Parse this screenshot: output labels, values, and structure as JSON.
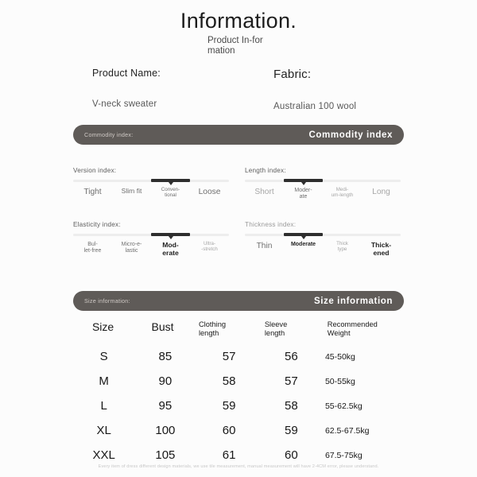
{
  "header": {
    "title": "Information.",
    "subtitle": "Product In-formation"
  },
  "product": {
    "name_label": "Product Name:",
    "name_value": "V-neck sweater",
    "fabric_label": "Fabric:",
    "fabric_value": "Australian 100 wool"
  },
  "commodity_banner": {
    "left": "Commodity index:",
    "right": "Commodity index"
  },
  "size_banner": {
    "left": "Size information:",
    "right": "Size information"
  },
  "indexes": [
    {
      "title": "Version index:",
      "selected": 3,
      "options": [
        "Tight",
        "Slim fit",
        "Conven-\ntional",
        "Loose"
      ]
    },
    {
      "title": "Length index:",
      "selected": 2,
      "options": [
        "Short",
        "Moder-\nate",
        "Medi-\num-length",
        "Long"
      ]
    },
    {
      "title": "Elasticity index:",
      "selected": 3,
      "options": [
        "Bul-\nlet-free",
        "Micro-e-\nlastic",
        "Mod-\nerate",
        "Ultra-\n-stretch"
      ]
    },
    {
      "title": "Thickness index:",
      "selected": 2,
      "options": [
        "Thin",
        "Moderate",
        "Thick\ntype",
        "Thick-\nened"
      ]
    }
  ],
  "size_table": {
    "headers": [
      "Size",
      "Bust",
      "Clothing\nlength",
      "Sleeve\nlength",
      "Recommended\nWeight"
    ],
    "rows": [
      {
        "size": "S",
        "bust": "85",
        "clothing_length": "57",
        "sleeve_length": "56",
        "weight": "45-50kg"
      },
      {
        "size": "M",
        "bust": "90",
        "clothing_length": "58",
        "sleeve_length": "57",
        "weight": "50-55kg"
      },
      {
        "size": "L",
        "bust": "95",
        "clothing_length": "59",
        "sleeve_length": "58",
        "weight": "55-62.5kg"
      },
      {
        "size": "XL",
        "bust": "100",
        "clothing_length": "60",
        "sleeve_length": "59",
        "weight": "62.5-67.5kg"
      },
      {
        "size": "XXL",
        "bust": "105",
        "clothing_length": "61",
        "sleeve_length": "60",
        "weight": "67.5-75kg"
      }
    ]
  },
  "footer": {
    "disclaimer": "Every item of dress different design materials, we use tile measurement, manual measurement will have 2-4CM error, please understand."
  },
  "colors": {
    "banner_bg": "#5f5b58",
    "track": "#ededed",
    "track_fill": "#2e2e2e",
    "page_bg": "#fcfcfc"
  }
}
